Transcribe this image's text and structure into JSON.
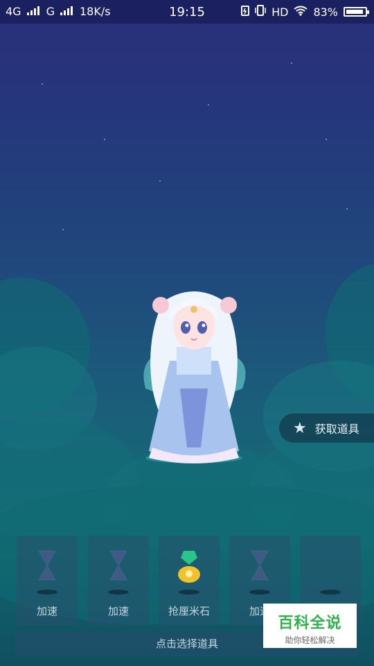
{
  "status_bar": {
    "network_1": "4G",
    "network_2": "G",
    "speed": "18K/s",
    "time": "19:15",
    "hd": "HD",
    "battery": "83%"
  },
  "side_button": {
    "label": "获取道具",
    "icon": "star-icon"
  },
  "items": [
    {
      "label": "加速",
      "icon": "hourglass-icon"
    },
    {
      "label": "加速",
      "icon": "hourglass-icon"
    },
    {
      "label": "抢厘米石",
      "icon": "gem-bag-icon"
    },
    {
      "label": "加速",
      "icon": "hourglass-icon"
    },
    {
      "label": "",
      "icon": ""
    }
  ],
  "select_hint": "点击选择道具",
  "watermark": {
    "title": "百科全说",
    "subtitle": "助你轻松解决"
  },
  "colors": {
    "accent_green": "#2fb24a",
    "panel": "#284f6e"
  }
}
